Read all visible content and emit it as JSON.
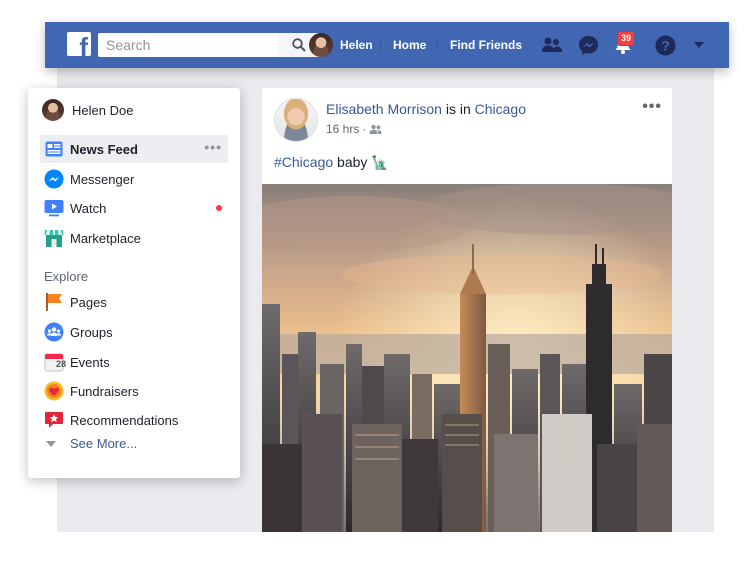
{
  "topbar": {
    "search_placeholder": "Search",
    "user_name": "Helen",
    "home_label": "Home",
    "find_friends_label": "Find Friends",
    "notifications_count": "39"
  },
  "sidebar": {
    "user_name": "Helen Doe",
    "items": [
      {
        "label": "News Feed",
        "icon": "news-feed-icon"
      },
      {
        "label": "Messenger",
        "icon": "messenger-icon"
      },
      {
        "label": "Watch",
        "icon": "watch-icon"
      },
      {
        "label": "Marketplace",
        "icon": "marketplace-icon"
      }
    ],
    "explore_label": "Explore",
    "explore_items": [
      {
        "label": "Pages",
        "icon": "flag-icon"
      },
      {
        "label": "Groups",
        "icon": "groups-icon"
      },
      {
        "label": "Events",
        "icon": "calendar-icon",
        "date": "28"
      },
      {
        "label": "Fundraisers",
        "icon": "fundraiser-icon"
      },
      {
        "label": "Recommendations",
        "icon": "recommendations-icon"
      }
    ],
    "see_more_label": "See More..."
  },
  "post": {
    "author": "Elisabeth Morrison",
    "is_in": "is in",
    "location": "Chicago",
    "time": "16 hrs",
    "separator": "·",
    "hashtag": "#Chicago",
    "text": "baby",
    "emoji": "🗽"
  },
  "colors": {
    "brand": "#4267b2",
    "link": "#365899",
    "badge": "#fa3e3e",
    "page_bg": "#e9ebee"
  }
}
